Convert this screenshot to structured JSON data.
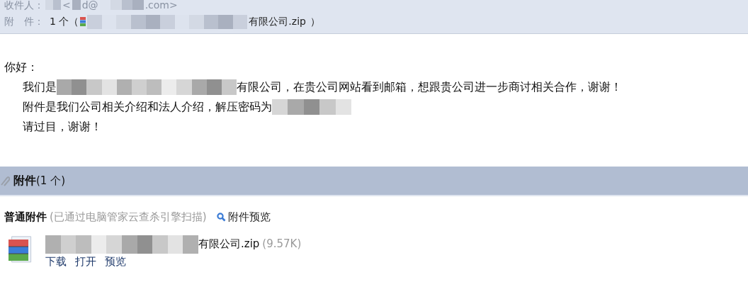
{
  "header": {
    "recipient_label": "收件人：",
    "recipient_parts": [
      "<",
      "d@",
      ".com>"
    ],
    "attachment_label": "附　件：",
    "attachment_count": "1 个（",
    "attachment_name_tail": "有限公司.zip",
    "attachment_close": "）"
  },
  "body": {
    "greeting": "你好：",
    "lines": [
      {
        "before": "我们是",
        "after": "有限公司，在贵公司网站看到邮箱，想跟贵公司进一步商讨相关合作，谢谢！",
        "redacted": true
      },
      {
        "before": "附件是我们公司相关介绍和法人介绍，解压密码为",
        "redacted": true
      },
      {
        "before": "请过目，谢谢！",
        "redacted": false
      }
    ]
  },
  "attachments": {
    "title": "附件",
    "count": "(1 个)",
    "section_label": "普通附件",
    "scan_note": "(已通过电脑管家云查杀引擎扫描)",
    "preview_link": "附件预览",
    "files": [
      {
        "name_tail": "有限公司.zip",
        "size": "(9.57K)",
        "actions": [
          "下载",
          "打开",
          "预览"
        ]
      }
    ]
  }
}
